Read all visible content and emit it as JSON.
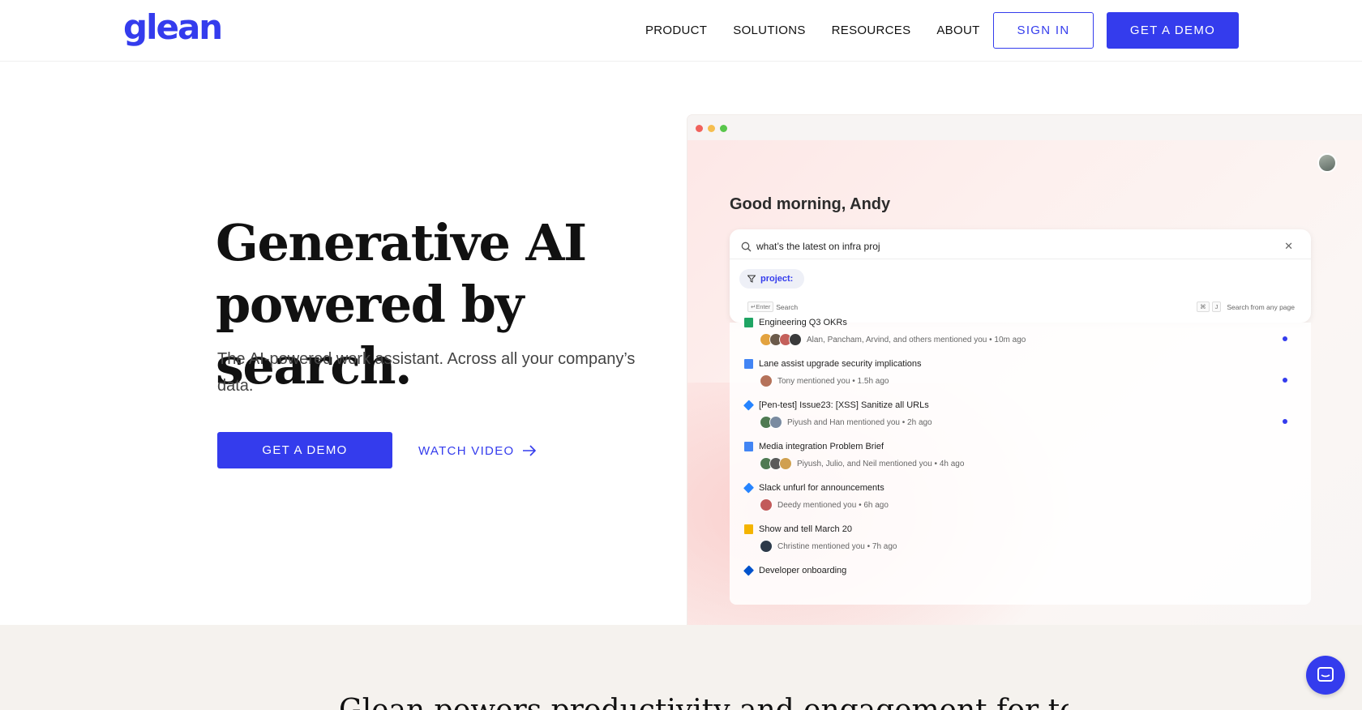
{
  "header": {
    "logo": "glean",
    "nav": [
      "PRODUCT",
      "SOLUTIONS",
      "RESOURCES",
      "ABOUT"
    ],
    "sign_in": "SIGN IN",
    "get_demo": "GET A DEMO"
  },
  "hero": {
    "title_line1": "Generative AI",
    "title_line2": "powered by search.",
    "subtitle": "The AI-powered work assistant. Across all your company’s data.",
    "cta_demo": "GET A DEMO",
    "cta_video": "WATCH VIDEO"
  },
  "mock": {
    "greeting": "Good morning, Andy",
    "search_query": "what’s the latest on infra proj",
    "chip": "project:",
    "hint_enter_key": "↵Enter",
    "hint_enter_label": "Search",
    "hint_cmd_key": "⌘",
    "hint_j_key": "J",
    "hint_any_page": "Search from any page",
    "feed": [
      {
        "title": "Engineering Q3 OKRs",
        "meta": "Alan, Pancham, Arvind, and others mentioned you • 10m ago",
        "icon_color": "#1fa463",
        "avatars": 4,
        "unread": true
      },
      {
        "title": "Lane assist upgrade security implications",
        "meta": "Tony mentioned you • 1.5h ago",
        "icon_color": "#4285f4",
        "avatars": 1,
        "unread": true
      },
      {
        "title": "[Pen-test] Issue23: [XSS] Sanitize all URLs",
        "meta": "Piyush and Han mentioned you • 2h ago",
        "icon_color": "#2684ff",
        "avatars": 2,
        "unread": true
      },
      {
        "title": "Media integration Problem Brief",
        "meta": "Piyush, Julio, and Neil mentioned you • 4h ago",
        "icon_color": "#4285f4",
        "avatars": 3,
        "unread": false
      },
      {
        "title": "Slack unfurl for announcements",
        "meta": "Deedy mentioned you • 6h ago",
        "icon_color": "#2684ff",
        "avatars": 1,
        "unread": false
      },
      {
        "title": "Show and tell March 20",
        "meta": "Christine mentioned you • 7h ago",
        "icon_color": "#f4b400",
        "avatars": 1,
        "unread": false
      },
      {
        "title": "Developer onboarding",
        "meta": "",
        "icon_color": "#0052cc",
        "avatars": 0,
        "unread": false
      }
    ]
  },
  "band": {
    "headline": "Glean powers productivity and engagement for today’s best companies"
  },
  "colors": {
    "accent": "#343ced",
    "band_bg": "#f5f2ee"
  }
}
